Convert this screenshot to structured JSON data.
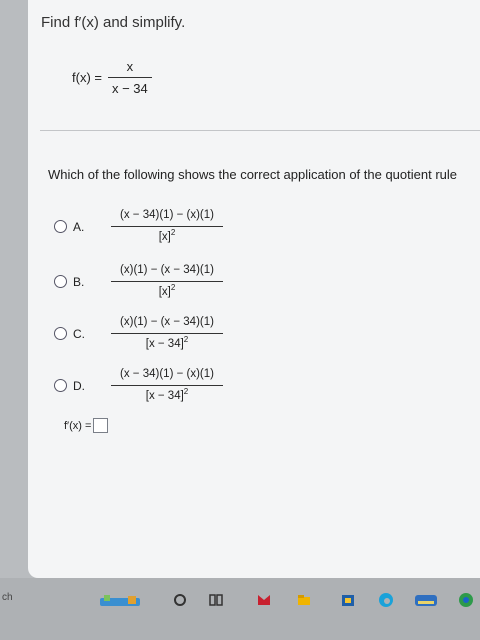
{
  "problem": {
    "title": "Find f′(x) and simplify.",
    "function_label": "f(x) =",
    "numerator": "x",
    "denominator": "x − 34"
  },
  "question": {
    "text": "Which of the following shows the correct application of the quotient rule"
  },
  "options": [
    {
      "letter": "A.",
      "numerator": "(x − 34)(1) − (x)(1)",
      "denominator": "[x]",
      "power": "2"
    },
    {
      "letter": "B.",
      "numerator": "(x)(1) − (x − 34)(1)",
      "denominator": "[x]",
      "power": "2"
    },
    {
      "letter": "C.",
      "numerator": "(x)(1) − (x − 34)(1)",
      "denominator": "[x − 34]",
      "power": "2"
    },
    {
      "letter": "D.",
      "numerator": "(x − 34)(1) − (x)(1)",
      "denominator": "[x − 34]",
      "power": "2"
    }
  ],
  "answer": {
    "label": "f′(x) =",
    "value": ""
  },
  "taskbar": {
    "search_stub": "ch",
    "icons": [
      "widgets-icon",
      "task-view-icon",
      "file-explorer-icon",
      "mcafee-icon",
      "files-icon",
      "store-icon",
      "edge-icon",
      "photos-icon",
      "chrome-icon"
    ]
  }
}
